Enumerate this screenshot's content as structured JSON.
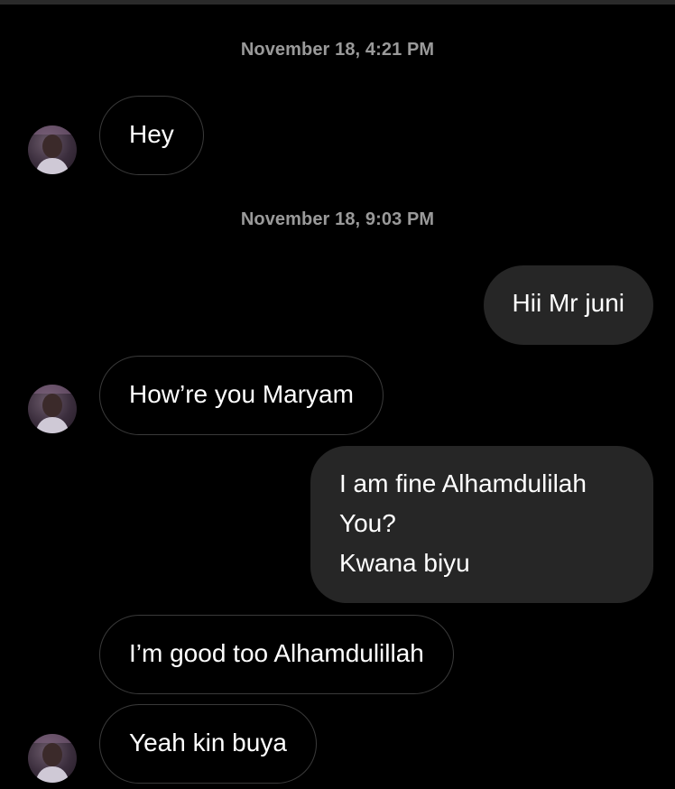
{
  "conversation": {
    "timestamps": [
      "November 18, 4:21 PM",
      "November 18, 9:03 PM"
    ],
    "messages": [
      {
        "sender": "incoming",
        "text": "Hey"
      },
      {
        "sender": "outgoing",
        "text": "Hii Mr juni"
      },
      {
        "sender": "incoming",
        "text": "How’re you Maryam"
      },
      {
        "sender": "outgoing",
        "text": "I am fine Alhamdulilah\nYou?\nKwana biyu"
      },
      {
        "sender": "incoming",
        "text": "I’m good too Alhamdulillah"
      },
      {
        "sender": "incoming",
        "text": "Yeah kin buya"
      }
    ]
  },
  "colors": {
    "background": "#000000",
    "outgoing_bubble": "#262626",
    "incoming_border": "#3a3a3a",
    "timestamp_text": "#9a9a9a"
  },
  "icons": {
    "avatar": "contact-avatar-photo"
  }
}
